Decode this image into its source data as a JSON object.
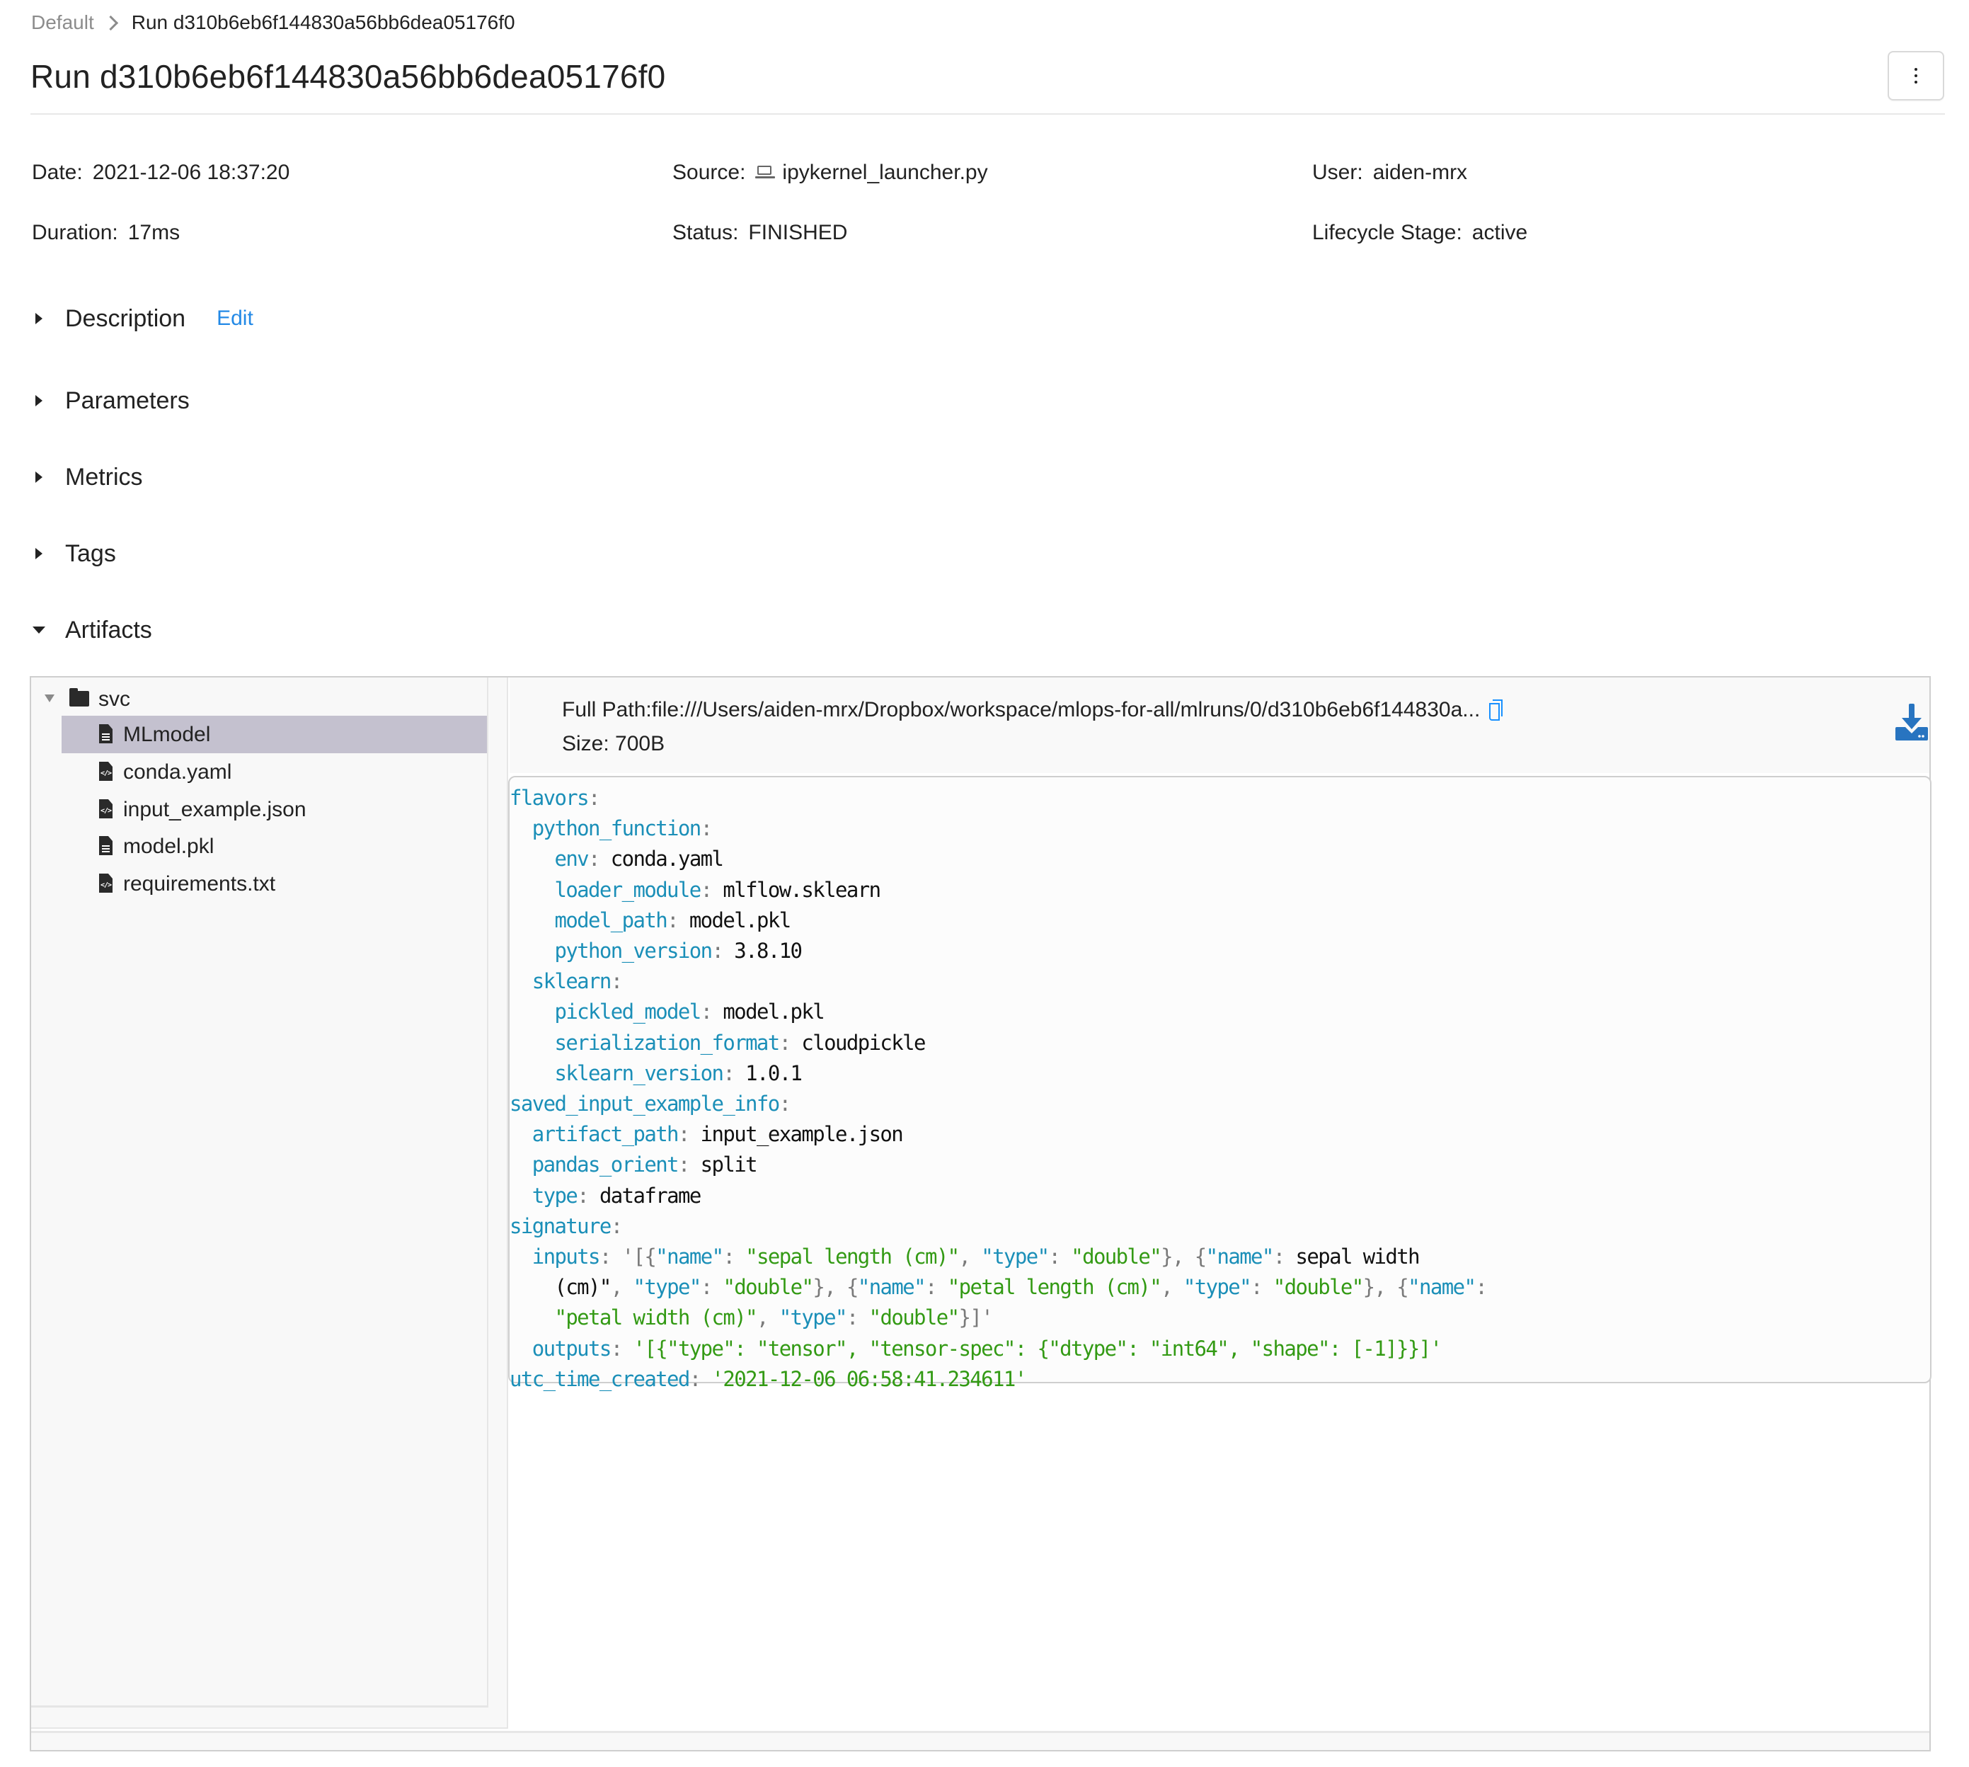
{
  "breadcrumb": {
    "root": "Default",
    "current": "Run d310b6eb6f144830a56bb6dea05176f0"
  },
  "header": {
    "title": "Run d310b6eb6f144830a56bb6dea05176f0",
    "more_menu_icon": "kebab-vertical-icon"
  },
  "info": {
    "date_label": "Date",
    "date_value": "2021-12-06 18:37:20",
    "source_label": "Source",
    "source_icon": "laptop-icon",
    "source_value": "ipykernel_launcher.py",
    "user_label": "User",
    "user_value": "aiden-mrx",
    "duration_label": "Duration",
    "duration_value": "17ms",
    "status_label": "Status",
    "status_value": "FINISHED",
    "lifecycle_label": "Lifecycle Stage",
    "lifecycle_value": "active",
    "separator": ":"
  },
  "sections": [
    {
      "label": "Description",
      "expanded": false,
      "action": "Edit"
    },
    {
      "label": "Parameters",
      "expanded": false
    },
    {
      "label": "Metrics",
      "expanded": false
    },
    {
      "label": "Tags",
      "expanded": false
    },
    {
      "label": "Artifacts",
      "expanded": true
    }
  ],
  "artifacts": {
    "tree": {
      "folder": {
        "name": "svc",
        "icon": "folder-icon",
        "expanded": true
      },
      "files": [
        {
          "name": "MLmodel",
          "icon": "file-text-icon",
          "selected": true
        },
        {
          "name": "conda.yaml",
          "icon": "file-code-icon",
          "selected": false
        },
        {
          "name": "input_example.json",
          "icon": "file-code-icon",
          "selected": false
        },
        {
          "name": "model.pkl",
          "icon": "file-text-icon",
          "selected": false
        },
        {
          "name": "requirements.txt",
          "icon": "file-code-icon",
          "selected": false
        }
      ]
    },
    "viewer": {
      "full_path_label": "Full Path:",
      "full_path_value": "file:///Users/aiden-mrx/Dropbox/workspace/mlops-for-all/mlruns/0/d310b6eb6f144830a...",
      "size_label": "Size:",
      "size_value": "700B",
      "copy_icon": "copy-icon",
      "download_icon": "download-icon",
      "accent_color": "#2874c0",
      "code_lines": [
        "flavors:",
        "  python_function:",
        "    env: conda.yaml",
        "    loader_module: mlflow.sklearn",
        "    model_path: model.pkl",
        "    python_version: 3.8.10",
        "  sklearn:",
        "    pickled_model: model.pkl",
        "    serialization_format: cloudpickle",
        "    sklearn_version: 1.0.1",
        "saved_input_example_info:",
        "  artifact_path: input_example.json",
        "  pandas_orient: split",
        "  type: dataframe",
        "signature:",
        "  inputs: '[{\"name\": \"sepal length (cm)\", \"type\": \"double\"}, {\"name\": \"sepal width",
        "    (cm)\", \"type\": \"double\"}, {\"name\": \"petal length (cm)\", \"type\": \"double\"}, {\"name\":",
        "    \"petal width (cm)\", \"type\": \"double\"}]'",
        "  outputs: '[{\"type\": \"tensor\", \"tensor-spec\": {\"dtype\": \"int64\", \"shape\": [-1]}}]'",
        "utc_time_created: '2021-12-06 06:58:41.234611'"
      ]
    }
  }
}
